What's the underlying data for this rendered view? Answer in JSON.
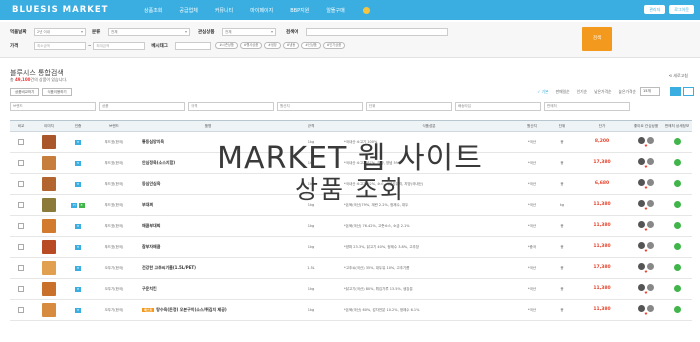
{
  "app": {
    "logo": "BLUESIS MARKET",
    "nav": [
      "상품조회",
      "공급업체",
      "커뮤니티",
      "마이페이지",
      "BBP지원",
      "알뜰구매"
    ],
    "top_right": [
      "관리자",
      "로그아웃"
    ]
  },
  "filter": {
    "labels": [
      "먹을날짜",
      "분류",
      "관심상품",
      "검색어",
      "가격",
      "베시태그"
    ],
    "date_value": "2년 이내",
    "category_value": "전체",
    "interest_value": "전체",
    "price_min_placeholder": "최소금액",
    "price_max_placeholder": "최대금액",
    "tags": [
      "#시즌상품",
      "#행사상품",
      "#냉장",
      "#냉동",
      "#신상품",
      "#인기상품"
    ],
    "search_button": "검색"
  },
  "section": {
    "title": "블루시스 통합검색",
    "count_prefix": "총 ",
    "count": "49,100",
    "count_suffix": "건의 상품이 있습니다.",
    "back_label": "새로고침"
  },
  "tools": {
    "buttons": [
      "상품비교하기",
      "식품이용하기"
    ],
    "sort": [
      "기본",
      "판매일순",
      "인기순",
      "낮은가격순",
      "높은가격순"
    ],
    "page_size": "15개"
  },
  "col_filters": [
    "브랜드",
    "상품",
    "규격",
    "원산지",
    "단위",
    "배송타입",
    "판매처"
  ],
  "table": {
    "headers": [
      "비교",
      "이미지",
      "인증",
      "브랜드",
      "품명",
      "규격",
      "식품성분",
      "원산지",
      "단위",
      "단가",
      "좋아요 관심상품",
      "판매처 상세정보"
    ],
    "rows": [
      {
        "brand": "푸드표(한국)",
        "name": "통등심양지육",
        "spec": "1kg",
        "ingr": "*국내산 소고기 100%",
        "origin": "*국산",
        "unit": "봉",
        "price": "8,200"
      },
      {
        "brand": "푸드표(한국)",
        "name": "안심정육(소스지함)",
        "spec": "1kg",
        "ingr": "*국내산 소고기 87%, 간장, 양념 5%",
        "origin": "*국산",
        "unit": "봉",
        "price": "17,380"
      },
      {
        "brand": "푸드표(한국)",
        "name": "등심안심육",
        "spec": "1kg",
        "ingr": "*국내산 소고기 92%, 소스, 식물성유지, 지방(국내산)",
        "origin": "*국산",
        "unit": "봉",
        "price": "6,680"
      },
      {
        "brand": "푸드표(한국)",
        "name": "부대찌",
        "spec": "1kg",
        "ingr": "*돈육(국산)79%, 계란 2.2%, 정제수, 대두",
        "origin": "*국산",
        "unit": "kg",
        "price": "11,380"
      },
      {
        "brand": "푸드표(한국)",
        "name": "매콤부대찌",
        "spec": "1kg",
        "ingr": "*돈육(국산) 76.42%, 고춧소스, 소금 2.1%",
        "origin": "*국산",
        "unit": "봉",
        "price": "11,380"
      },
      {
        "brand": "푸드표(한국)",
        "name": "참부자매콤",
        "spec": "1kg",
        "ingr": "*양파 23.3%, 닭고기 40%, 정제수 3.8%, 고추장",
        "origin": "*중국",
        "unit": "봉",
        "price": "11,380"
      },
      {
        "brand": "오뚜기(한국)",
        "name": "건강한 고추씨기름(1.5L/PET)",
        "spec": "1.5L",
        "ingr": "*고추씨(국산) 35%, 대두유 10%, 고추기름",
        "origin": "*국산",
        "unit": "봉",
        "price": "17,380"
      },
      {
        "brand": "오뚜기(한국)",
        "name": "구운치킨",
        "spec": "1kg",
        "ingr": "*닭고기(국산) 80%, 튀김가루 13.5%, 생강분",
        "origin": "*국산",
        "unit": "봉",
        "price": "11,380"
      },
      {
        "brand": "오뚜기(한국)",
        "name": "탕수육(돈정) 오븐구이(소스/튀김지 제공)",
        "spec": "1kg",
        "ingr": "*돈육(국산) 60%, 감자전분 10.2%, 정제수 6.1%",
        "origin": "*국산",
        "unit": "봉",
        "price": "11,380",
        "tag": "베스트"
      }
    ]
  },
  "overlay": {
    "line1": "MARKET 웹 사이트",
    "line2": "상품 조회"
  },
  "colors": {
    "brand": "#3aaee0",
    "accent": "#f39a1e",
    "price": "#e8412b"
  }
}
